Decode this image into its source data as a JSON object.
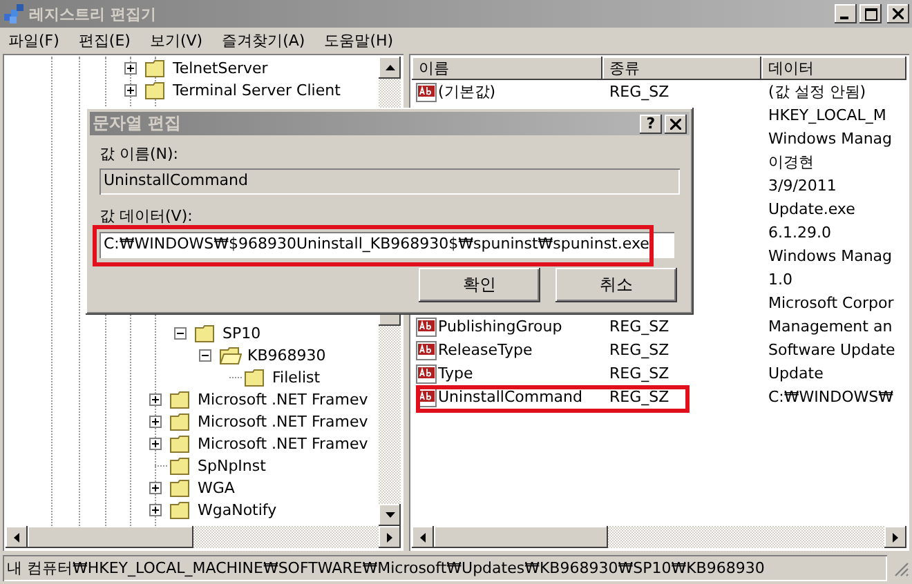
{
  "window": {
    "title": "레지스트리 편집기"
  },
  "menu": [
    "파일(F)",
    "편집(E)",
    "보기(V)",
    "즐겨찾기(A)",
    "도움말(H)"
  ],
  "tree_top": [
    {
      "label": "TelnetServer",
      "kind": "collapsed",
      "selected": false
    },
    {
      "label": "Terminal Server Client",
      "kind": "collapsed",
      "selected": false
    }
  ],
  "tree_bottom": [
    {
      "label": "SP10",
      "kind": "expanded",
      "selected": false,
      "children": [
        {
          "label": "KB968930",
          "kind": "expanded",
          "selected": true,
          "children": [
            {
              "label": "Filelist",
              "kind": "leaf",
              "selected": false
            }
          ]
        }
      ]
    }
  ],
  "tree_bottom_siblings": [
    {
      "label": "Microsoft .NET Framev",
      "kind": "collapsed",
      "selected": false
    },
    {
      "label": "Microsoft .NET Framev",
      "kind": "collapsed",
      "selected": false
    },
    {
      "label": "Microsoft .NET Framev",
      "kind": "collapsed",
      "selected": false
    },
    {
      "label": "SpNpInst",
      "kind": "leaf",
      "selected": false
    },
    {
      "label": "WGA",
      "kind": "collapsed",
      "selected": false
    },
    {
      "label": "WgaNotify",
      "kind": "collapsed",
      "selected": false
    }
  ],
  "list": {
    "columns": [
      "이름",
      "종류",
      "데이터"
    ],
    "rows": [
      {
        "name": "(기본값)",
        "type": "REG_SZ",
        "data": "(값 설정 안됨)",
        "highlighted": false
      },
      {
        "data": "HKEY_LOCAL_M"
      },
      {
        "data": "Windows Manag"
      },
      {
        "data": "이경현"
      },
      {
        "data": "3/9/2011"
      },
      {
        "data": "Update.exe"
      },
      {
        "data": "6.1.29.0"
      },
      {
        "data": "Windows Manag"
      },
      {
        "data": "1.0"
      },
      {
        "data": "Microsoft Corpor"
      },
      {
        "name": "PublishingGroup",
        "type": "REG_SZ",
        "data": "Management an",
        "highlighted": false
      },
      {
        "name": "ReleaseType",
        "type": "REG_SZ",
        "data": "Software Update",
        "highlighted": false
      },
      {
        "name": "Type",
        "type": "REG_SZ",
        "data": "Update",
        "highlighted": false
      },
      {
        "name": "UninstallCommand",
        "type": "REG_SZ",
        "data": "C:₩WINDOWS₩",
        "highlighted": true
      }
    ]
  },
  "dialog": {
    "title": "문자열 편집",
    "help": "?",
    "name_label": "값 이름(N):",
    "name_value": "UninstallCommand",
    "data_label": "값 데이터(V):",
    "data_value": "C:₩WINDOWS₩$968930Uninstall_KB968930$₩spuninst₩spuninst.exe",
    "data_highlighted": true,
    "buttons": [
      "확인",
      "취소"
    ]
  },
  "status_bar": "내 컴퓨터₩HKEY_LOCAL_MACHINE₩SOFTWARE₩Microsoft₩Updates₩KB968930₩SP10₩KB968930"
}
